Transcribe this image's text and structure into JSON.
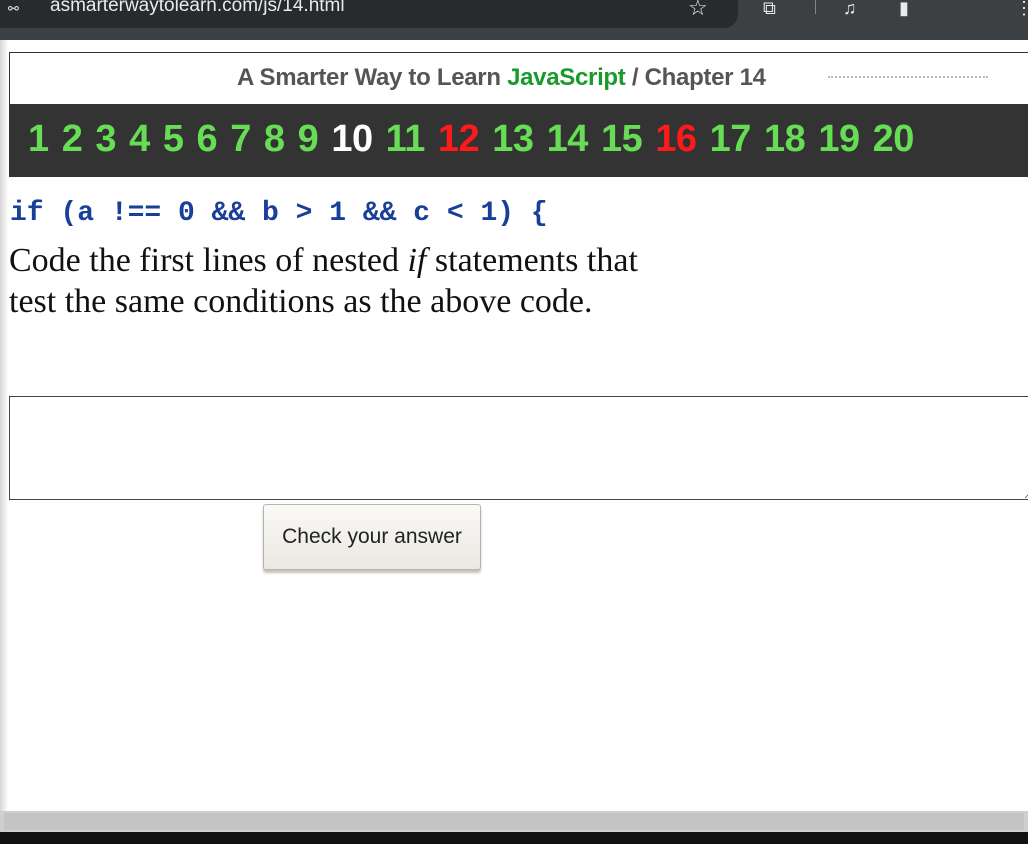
{
  "browser": {
    "url": "asmarterwaytolearn.com/js/14.html",
    "icons": [
      "site-info-icon",
      "bookmark-star-icon",
      "extensions-icon",
      "media-icon",
      "sidepanel-icon",
      "more-menu-icon"
    ]
  },
  "header": {
    "title_prefix": "A Smarter Way to Learn",
    "title_brand": "JavaScript",
    "separator": "/",
    "chapter": "Chapter 14"
  },
  "chapters": [
    {
      "label": "1",
      "state": "normal"
    },
    {
      "label": "2",
      "state": "normal"
    },
    {
      "label": "3",
      "state": "normal"
    },
    {
      "label": "4",
      "state": "normal"
    },
    {
      "label": "5",
      "state": "normal"
    },
    {
      "label": "6",
      "state": "normal"
    },
    {
      "label": "7",
      "state": "normal"
    },
    {
      "label": "8",
      "state": "normal"
    },
    {
      "label": "9",
      "state": "normal"
    },
    {
      "label": "10",
      "state": "current"
    },
    {
      "label": "11",
      "state": "normal"
    },
    {
      "label": "12",
      "state": "highlight"
    },
    {
      "label": "13",
      "state": "normal"
    },
    {
      "label": "14",
      "state": "normal"
    },
    {
      "label": "15",
      "state": "normal"
    },
    {
      "label": "16",
      "state": "highlight"
    },
    {
      "label": "17",
      "state": "normal"
    },
    {
      "label": "18",
      "state": "normal"
    },
    {
      "label": "19",
      "state": "normal"
    },
    {
      "label": "20",
      "state": "normal"
    }
  ],
  "exercise": {
    "code": "if (a !== 0 && b > 1 && c < 1) {",
    "prompt_before": "Code the first lines of nested ",
    "prompt_em": "if",
    "prompt_after": " statements that test the same conditions as the above code.",
    "answer_value": "",
    "check_label": "Check your answer"
  },
  "colors": {
    "brand": "#1a9a2a",
    "chapter_normal": "#66dd55",
    "chapter_current": "#ffffff",
    "chapter_highlight": "#ff1a1a",
    "code": "#1a3f99",
    "bar": "#333333"
  }
}
